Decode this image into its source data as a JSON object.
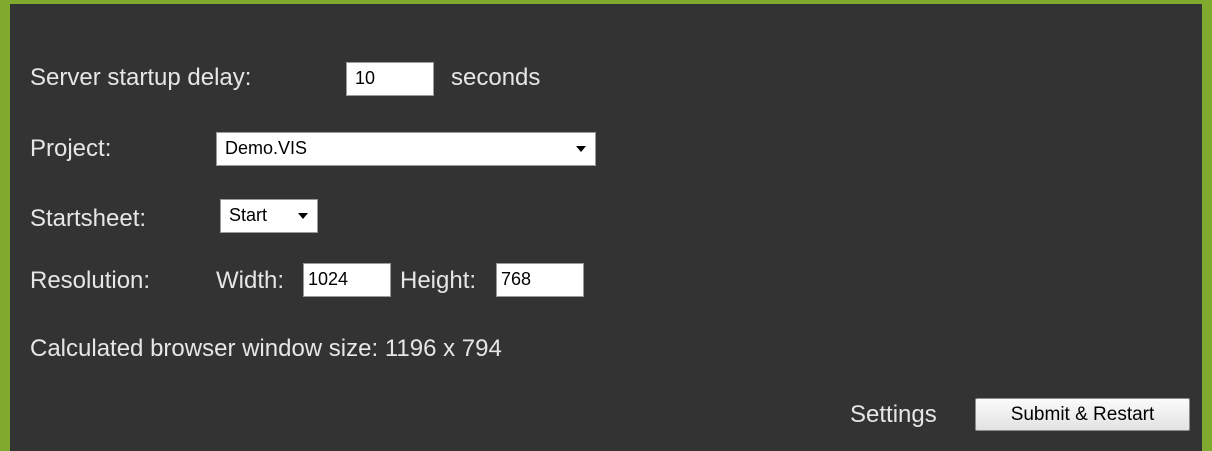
{
  "startup": {
    "label": "Server startup delay:",
    "value": "10",
    "unit": "seconds"
  },
  "project": {
    "label": "Project:",
    "selected": "Demo.VIS"
  },
  "startsheet": {
    "label": "Startsheet:",
    "selected": "Start"
  },
  "resolution": {
    "label": "Resolution:",
    "width_label": "Width:",
    "width_value": "1024",
    "height_label": "Height:",
    "height_value": "768"
  },
  "calculated": {
    "text": "Calculated browser window size: 1196 x 794"
  },
  "footer": {
    "settings_label": "Settings",
    "submit_label": "Submit & Restart"
  },
  "colors": {
    "border": "#7faa2e",
    "background": "#333333",
    "text": "#e6e6e6"
  }
}
